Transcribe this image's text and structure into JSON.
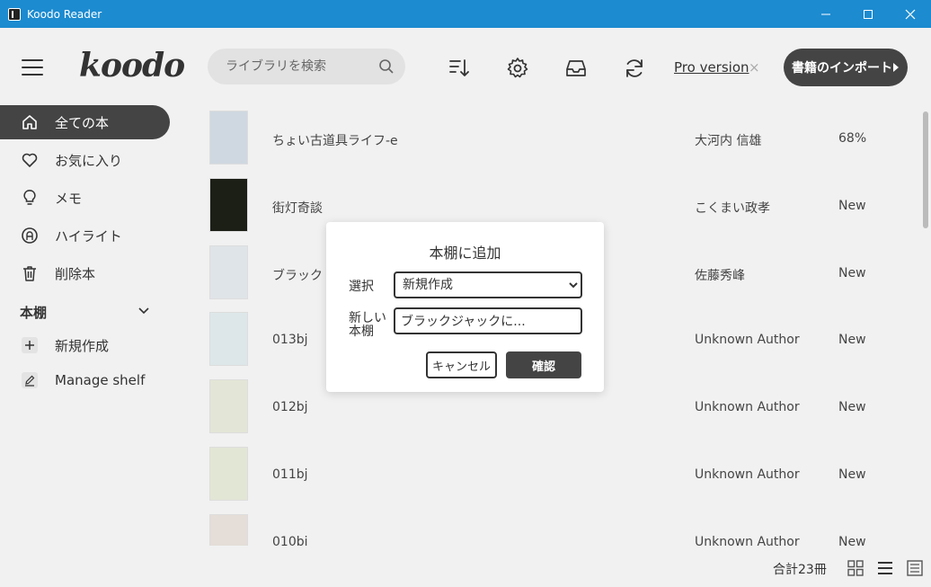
{
  "window": {
    "title": "Koodo Reader",
    "minimize": "—",
    "maximize": "☐",
    "close": "✕"
  },
  "logo": "koodo",
  "sidebar": {
    "items": [
      {
        "label": "全ての本",
        "icon": "home-icon",
        "active": true
      },
      {
        "label": "お気に入り",
        "icon": "heart-icon"
      },
      {
        "label": "メモ",
        "icon": "lightbulb-icon"
      },
      {
        "label": "ハイライト",
        "icon": "highlight-icon"
      },
      {
        "label": "削除本",
        "icon": "trash-icon"
      }
    ],
    "shelf_header": "本棚",
    "shelf_items": [
      {
        "label": "新規作成",
        "icon": "plus-icon"
      },
      {
        "label": "Manage shelf",
        "icon": "edit-icon"
      }
    ]
  },
  "header": {
    "search_placeholder": "ライブラリを検索",
    "pro_label": "Pro version",
    "pro_close": "×",
    "import_label": "書籍のインポート"
  },
  "books": [
    {
      "title": "ちょい古道具ライフ-e",
      "author": "大河内 信雄",
      "progress": "68%",
      "cover_color": "#cfd8e0"
    },
    {
      "title": "街灯奇談",
      "author": "こくまい政孝",
      "progress": "New",
      "cover_color": "#1c1f16"
    },
    {
      "title": "ブラック",
      "author": "佐藤秀峰",
      "progress": "New",
      "cover_color": "#dfe4e8"
    },
    {
      "title": "013bj",
      "author": "Unknown Author",
      "progress": "New",
      "cover_color": "#dde7ea"
    },
    {
      "title": "012bj",
      "author": "Unknown Author",
      "progress": "New",
      "cover_color": "#e3e5d6"
    },
    {
      "title": "011bj",
      "author": "Unknown Author",
      "progress": "New",
      "cover_color": "#e2e6d5"
    },
    {
      "title": "010bj",
      "author": "Unknown Author",
      "progress": "New",
      "cover_color": "#e4ddd8"
    }
  ],
  "footer": {
    "total": "合計23冊"
  },
  "dialog": {
    "title": "本棚に追加",
    "select_label": "選択",
    "select_value": "新規作成",
    "name_label": "新しい本棚",
    "name_value": "ブラックジャックに...",
    "cancel_label": "キャンセル",
    "confirm_label": "確認"
  }
}
